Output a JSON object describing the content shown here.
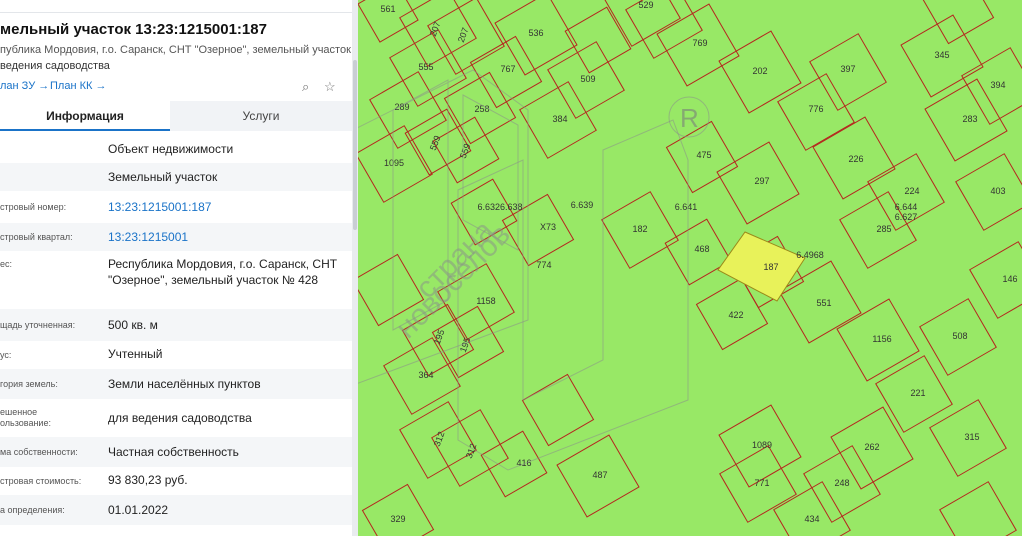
{
  "panel": {
    "title": "мельный участок 13:23:1215001:187",
    "subtitle": "публика Мордовия, г.о. Саранск, СНТ \"Озерное\", земельный участок № 428",
    "subtitle2": "ведения садоводства",
    "link_zu": "лан ЗУ →",
    "link_kk": "План КК →",
    "tab_info": "Информация",
    "tab_services": "Услуги",
    "rows": [
      {
        "label": "",
        "value": "Объект недвижимости"
      },
      {
        "label": "",
        "value": "Земельный участок"
      },
      {
        "label": "стровый номер:",
        "value": "13:23:1215001:187"
      },
      {
        "label": "стровый квартал:",
        "value": "13:23:1215001"
      },
      {
        "label": "ес:",
        "value": "Республика Мордовия, г.о. Саранск, СНТ \"Озерное\", земельный участок № 428"
      },
      {
        "label": "щадь уточненная:",
        "value": "500 кв. м"
      },
      {
        "label": "ус:",
        "value": "Учтенный"
      },
      {
        "label": "гория земель:",
        "value": "Земли населённых пунктов"
      },
      {
        "label": "ешенное\nользование:",
        "value": "для ведения садоводства"
      },
      {
        "label": "ма собственности:",
        "value": "Частная собственность"
      },
      {
        "label": "стровая стоимость:",
        "value": "93 830,23 руб."
      },
      {
        "label": "а определения:",
        "value": "01.01.2022"
      }
    ]
  },
  "map": {
    "background_color": "#98e866",
    "border_color": "#b5261e",
    "highlight_color": "#e8f25a",
    "parcel_labels": [
      "561",
      "207",
      "207",
      "536",
      "529",
      "769",
      "555",
      "767",
      "202",
      "397",
      "345",
      "394",
      "289",
      "258",
      "509",
      "776",
      "384",
      "283",
      "559",
      "559",
      "1095",
      "475",
      "226",
      "297",
      "224",
      "403",
      "6.6326.638",
      "6.639",
      "6.641",
      "6.644",
      "6.627",
      "X73",
      "182",
      "468",
      "285",
      "774",
      "187",
      "6.4968",
      "146",
      "1158",
      "422",
      "551",
      "1156",
      "508",
      "195",
      "195",
      "364",
      "221",
      "312",
      "312",
      "416",
      "487",
      "1089",
      "262",
      "315",
      "771",
      "248",
      "329",
      "434"
    ],
    "watermark_text_1": "страна",
    "watermark_text_2": "новоселов",
    "watermark_mark": "R"
  }
}
